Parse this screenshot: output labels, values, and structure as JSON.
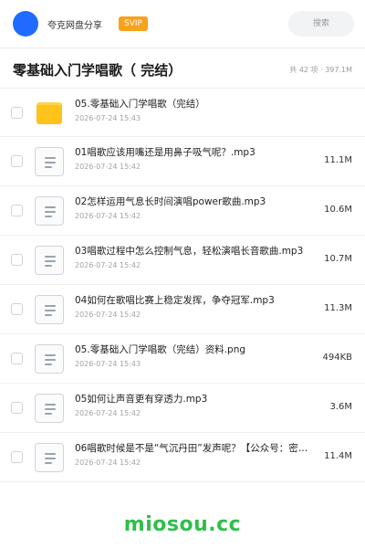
{
  "header": {
    "brand": "夸克网盘分享",
    "vip_badge": "SVIP",
    "search_placeholder": "搜索"
  },
  "folder": {
    "title": "零基础入门学唱歌（ 完结）",
    "summary": "共 42 项 · 397.1M"
  },
  "files": [
    {
      "type": "folder",
      "icon": "folder-icon",
      "name": "05.零基础入门学唱歌（完结）",
      "date": "2026-07-24 15:43",
      "size": ""
    },
    {
      "type": "file",
      "icon": "document-icon",
      "name": "01唱歌应该用嘴还是用鼻子吸气呢？.mp3",
      "date": "2026-07-24 15:42",
      "size": "11.1M"
    },
    {
      "type": "file",
      "icon": "document-icon",
      "name": "02怎样运用气息长时间演唱power歌曲.mp3",
      "date": "2026-07-24 15:42",
      "size": "10.6M"
    },
    {
      "type": "file",
      "icon": "document-icon",
      "name": "03唱歌过程中怎么控制气息，轻松演唱长音歌曲.mp3",
      "date": "2026-07-24 15:42",
      "size": "10.7M"
    },
    {
      "type": "file",
      "icon": "document-icon",
      "name": "04如何在歌唱比赛上稳定发挥，争夺冠军.mp3",
      "date": "2026-07-24 15:42",
      "size": "11.3M"
    },
    {
      "type": "file",
      "icon": "document-icon",
      "name": "05.零基础入门学唱歌（完结）资料.png",
      "date": "2026-07-24 15:43",
      "size": "494KB"
    },
    {
      "type": "file",
      "icon": "document-icon",
      "name": "05如何让声音更有穿透力.mp3",
      "date": "2026-07-24 15:42",
      "size": "3.6M"
    },
    {
      "type": "file",
      "icon": "document-icon",
      "name": "06唱歌时候是不是“气沉丹田”发声呢？【公众号：密…",
      "date": "2026-07-24 15:42",
      "size": "11.4M"
    }
  ],
  "watermark": "miosou.cc",
  "colors": {
    "accent": "#1f6bff",
    "vip": "#f7a21b",
    "folder": "#ffc31a",
    "watermark": "#2fbf4a"
  }
}
